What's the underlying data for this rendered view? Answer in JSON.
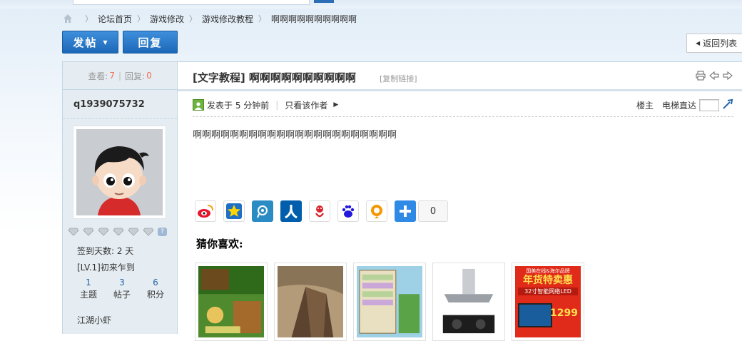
{
  "breadcrumb": {
    "items": [
      "论坛首页",
      "游戏修改",
      "游戏修改教程",
      "啊啊啊啊啊啊啊啊啊啊"
    ]
  },
  "actions": {
    "post_label": "发帖",
    "reply_label": "回复",
    "back_label": "返回列表"
  },
  "stats": {
    "views_label": "查看:",
    "views": "7",
    "replies_label": "回复:",
    "replies": "0"
  },
  "author": {
    "name": "q1939075732",
    "signin_days": "签到天数: 2 天",
    "level": "[LV.1]初来乍到",
    "counts": [
      {
        "value": "1",
        "label": "主题"
      },
      {
        "value": "3",
        "label": "帖子"
      },
      {
        "value": "6",
        "label": "积分"
      }
    ],
    "group": "江湖小虾"
  },
  "post": {
    "title": "[文字教程] 啊啊啊啊啊啊啊啊啊啊",
    "copy_link": "[复制链接]",
    "posted": "发表于 5 分钟前",
    "only_author": "只看该作者",
    "floor": "楼主",
    "jump_label": "电梯直达",
    "body": "啊啊啊啊啊啊啊啊啊啊啊啊啊啊啊啊啊啊啊啊啊啊",
    "share_count": "0"
  },
  "share_icons": [
    {
      "icon": "weibo-icon",
      "color": "#e6162d"
    },
    {
      "icon": "qzone-icon",
      "color": "#f4b400"
    },
    {
      "icon": "tencent-weibo-icon",
      "color": "#2b8cc4"
    },
    {
      "icon": "renren-icon",
      "color": "#005eac"
    },
    {
      "icon": "kaixin-icon",
      "color": "#d9262c"
    },
    {
      "icon": "baidu-icon",
      "color": "#2319dc"
    },
    {
      "icon": "pengyou-icon",
      "color": "#f39800"
    },
    {
      "icon": "more-share-icon",
      "color": "#2f8ae5"
    }
  ],
  "recommend": {
    "title": "猜你喜欢:",
    "items": [
      {
        "name": "game-screenshot-thumb"
      },
      {
        "name": "building-photo-thumb"
      },
      {
        "name": "game-ui-thumb"
      },
      {
        "name": "range-hood-thumb"
      },
      {
        "name": "tv-sale-thumb",
        "caption": "年货特卖惠",
        "subtitle": "32寸智能网络LED",
        "price": "1299",
        "brand": "国美在线&海尔品牌"
      }
    ]
  }
}
